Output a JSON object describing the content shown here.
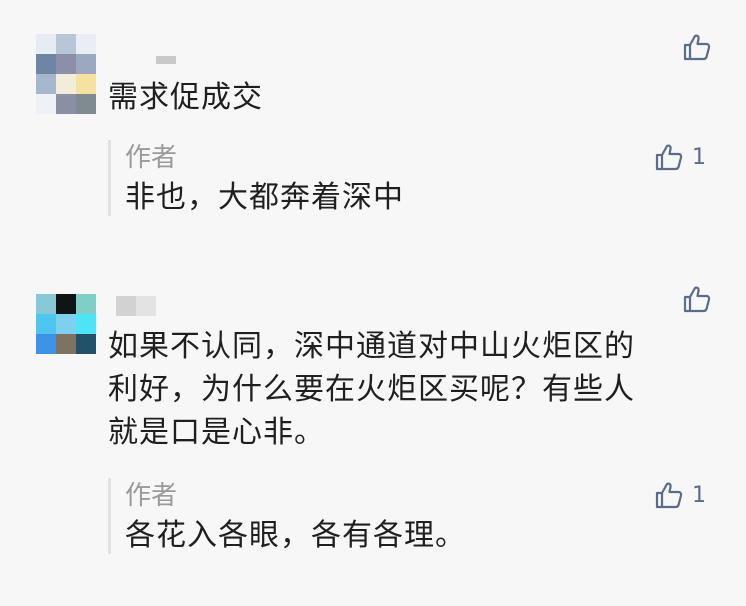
{
  "comments": [
    {
      "text_lines": [
        "需求促成交"
      ],
      "like_count": "",
      "reply": {
        "author": "作者",
        "text": "非也，大都奔着深中",
        "like_count": "1"
      }
    },
    {
      "text_lines": [
        "如果不认同，深中通道对中山火炬区的",
        "利好，为什么要在火炬区买呢？有些人",
        "就是口是心非。"
      ],
      "like_count": "",
      "reply": {
        "author": "作者",
        "text": "各花入各眼，各有各理。",
        "like_count": "1"
      }
    }
  ],
  "icons": {
    "like": "thumbs-up-icon"
  },
  "colors": {
    "background": "#f7f7f7",
    "link_blue": "#5a6b8c",
    "reply_author": "#9a9a9a"
  }
}
